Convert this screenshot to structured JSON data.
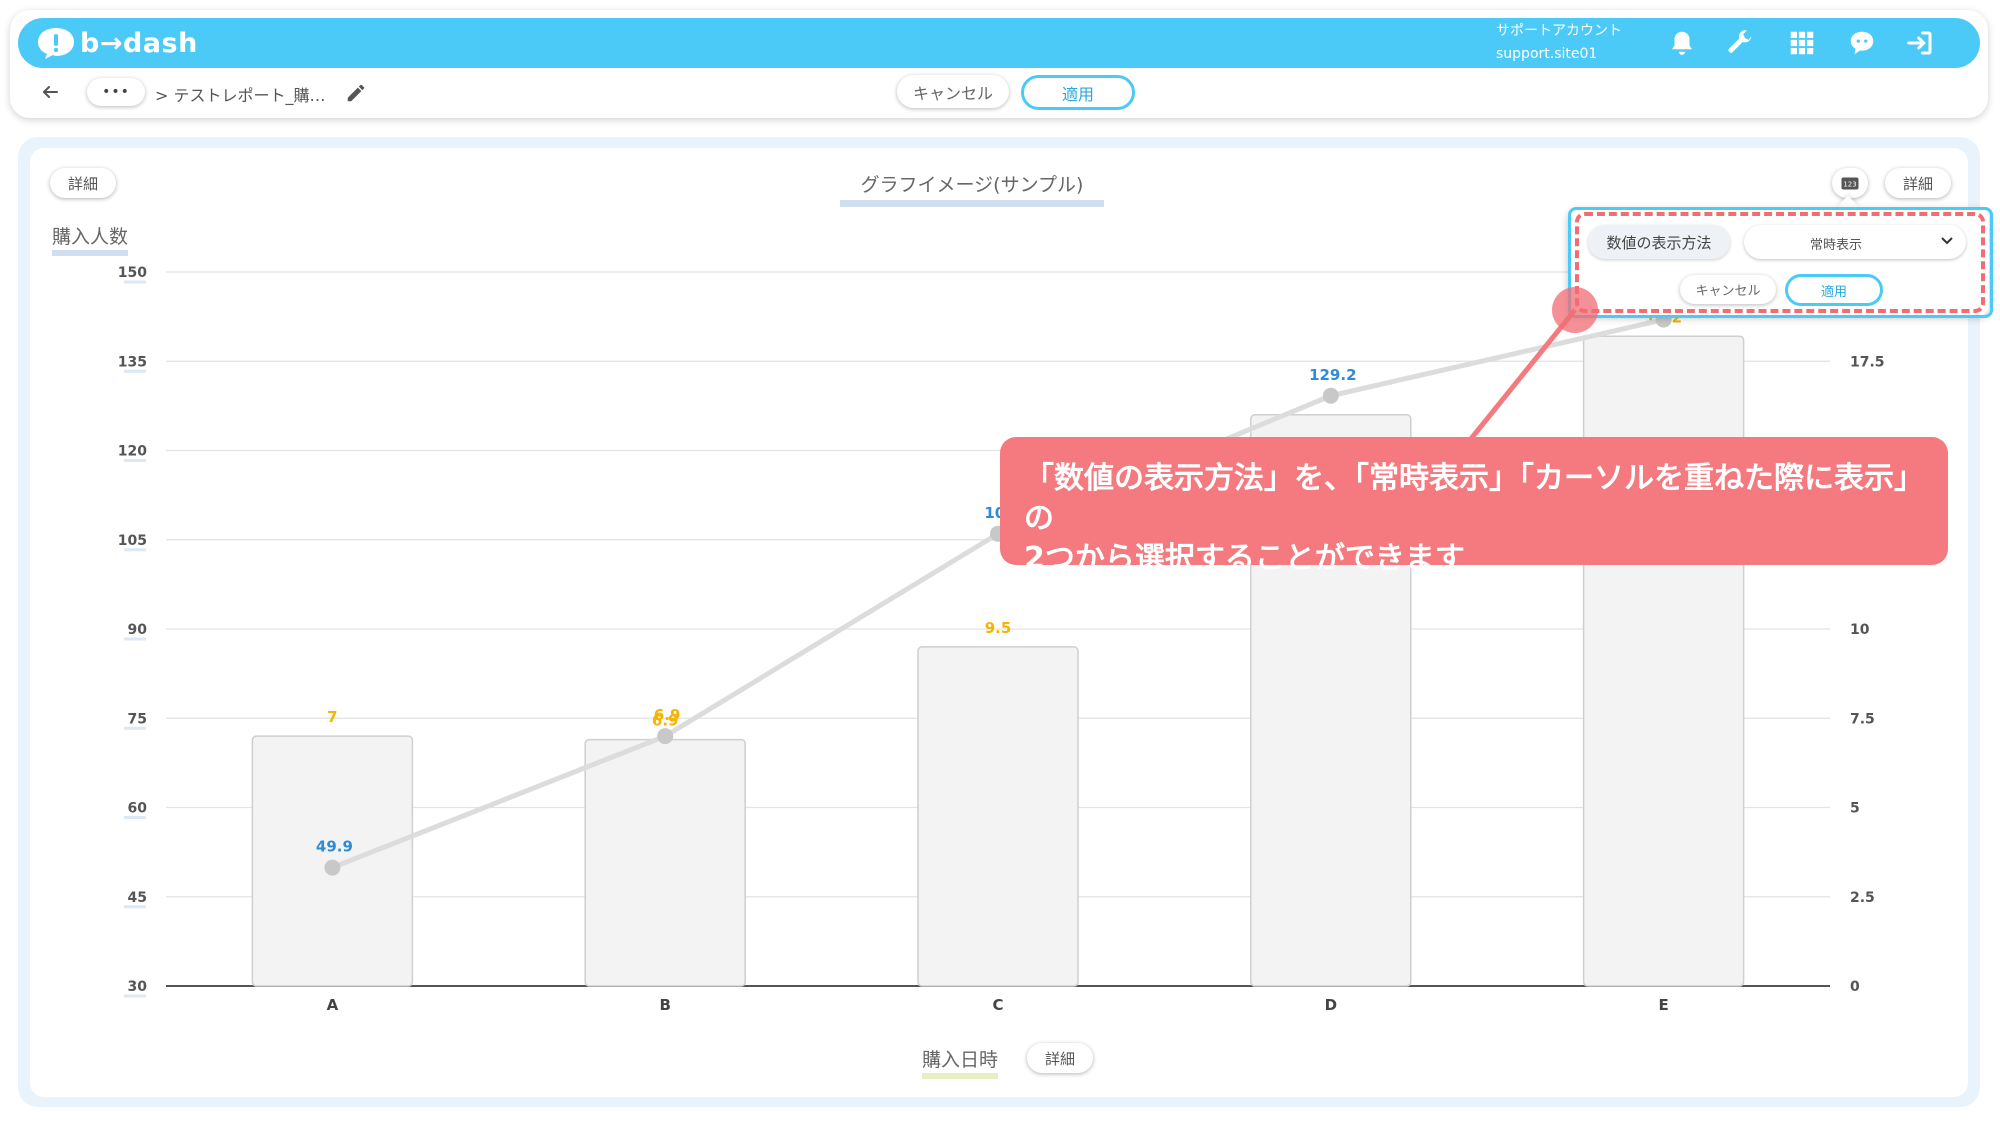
{
  "header": {
    "logo_text": "b→dash",
    "account_label": "サポートアカウント",
    "account_id": "support.site01",
    "icons": [
      "bell-icon",
      "wrench-icon",
      "grid-icon",
      "chat-bubble-icon",
      "logout-icon"
    ]
  },
  "toolbar": {
    "ellipsis": "•••",
    "breadcrumb": "> テストレポート_購…",
    "cancel_label": "キャンセル",
    "apply_label": "適用"
  },
  "chart_panel": {
    "detail_label": "詳細",
    "title": "グラフイメージ(サンプル)",
    "y_axis_title": "購入人数",
    "x_axis_title": "購入日時"
  },
  "popover": {
    "field_label": "数値の表示方法",
    "selected_value": "常時表示",
    "cancel_label": "キャンセル",
    "apply_label": "適用"
  },
  "annotation": {
    "line1": "「数値の表示方法」を、「常時表示」「カーソルを重ねた際に表示」の",
    "line2": "2つから選択することができます"
  },
  "colors": {
    "brand": "#4bcaf8",
    "accent_pink": "#f47a7f",
    "bar_label": "#f5b400",
    "line_label": "#2d8bd8"
  },
  "chart_data": {
    "type": "bar+line",
    "categories": [
      "A",
      "B",
      "C",
      "D",
      "E"
    ],
    "series": [
      {
        "type": "bar",
        "axis": "right",
        "values": [
          7,
          6.9,
          9.5,
          16,
          18.2
        ],
        "labels": [
          "7",
          "6.9",
          "9.5",
          "",
          "18.2"
        ]
      },
      {
        "type": "line",
        "axis": "left",
        "values": [
          49.9,
          72,
          106,
          129.2,
          142
        ],
        "labels": [
          "49.9",
          "6.9",
          "106",
          "129.2",
          ""
        ]
      }
    ],
    "y_left": {
      "min": 30,
      "max": 150,
      "ticks": [
        30,
        45,
        60,
        75,
        90,
        105,
        120,
        135,
        150
      ]
    },
    "y_right": {
      "min": 0,
      "max": 20,
      "ticks": [
        "0",
        "2.5",
        "5",
        "7.5",
        "10",
        "",
        "",
        "17.5",
        ""
      ]
    },
    "grid": true
  }
}
